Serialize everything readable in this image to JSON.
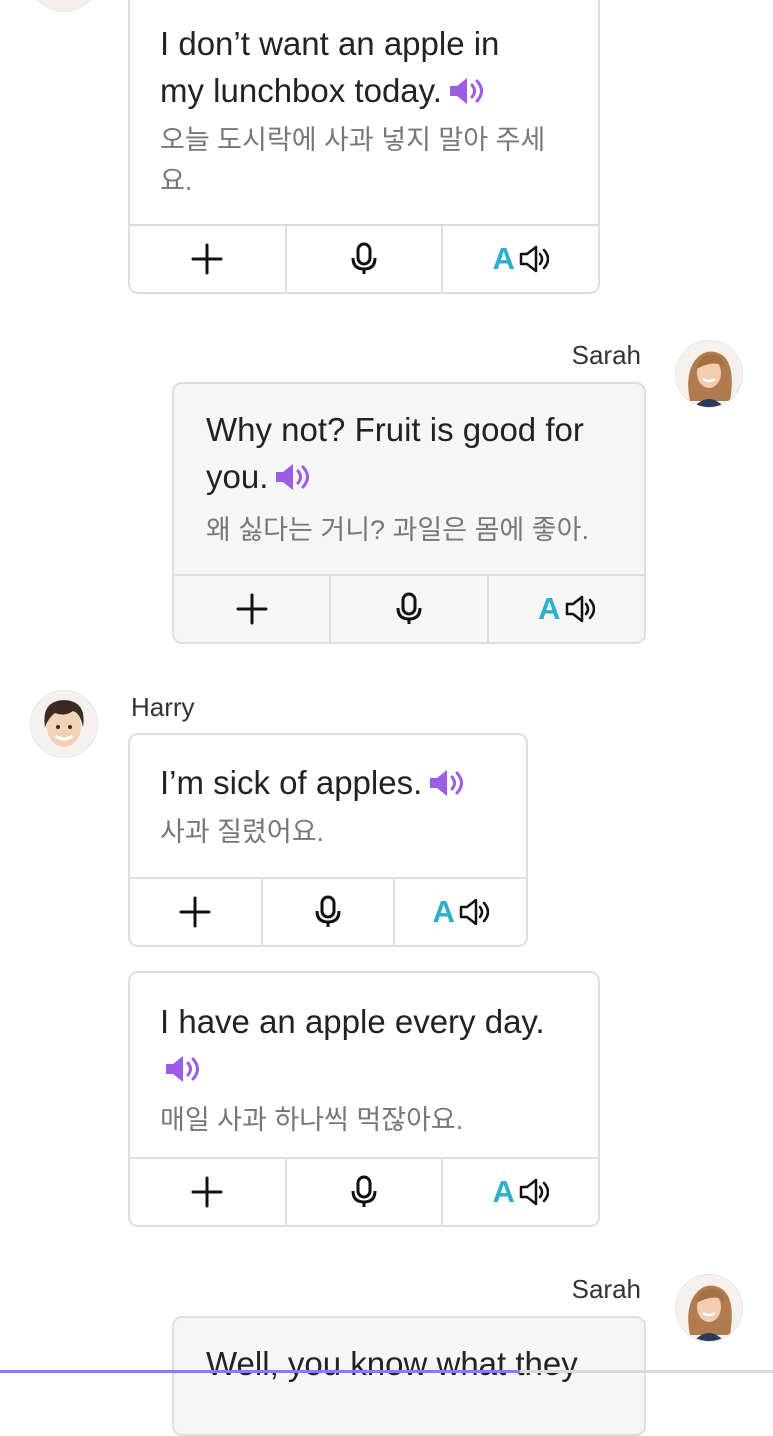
{
  "messages": [
    {
      "speaker": "",
      "english": "I don’t want an apple in my lunchbox today.",
      "english_lines": [
        "I don’t want an apple in",
        "my lunchbox today."
      ],
      "korean_lines": [
        "오늘 도시락에 사과 넣지 말아 주세",
        "요."
      ]
    },
    {
      "speaker": "Sarah",
      "english_lines": [
        "Why not? Fruit is good for",
        "you."
      ],
      "korean_lines": [
        "왜 싫다는 거니? 과일은 몸에 좋아."
      ]
    },
    {
      "speaker": "Harry",
      "english_lines": [
        "I’m sick of apples."
      ],
      "korean_lines": [
        "사과 질렸어요."
      ]
    },
    {
      "speaker": "",
      "english_lines": [
        "I have an apple every day.",
        ""
      ],
      "korean_lines": [
        "매일 사과 하나씩 먹잖아요."
      ]
    },
    {
      "speaker": "Sarah",
      "english_lines": [
        "Well, you know what they"
      ]
    }
  ],
  "actions": {
    "add_icon": "plus-icon",
    "record_icon": "microphone-icon",
    "listen_letter": "A",
    "listen_icon": "speaker-outline-icon"
  },
  "colors": {
    "accent_purple": "#9b5de5",
    "accent_teal": "#2ab0c8",
    "border": "#dedede",
    "korean_text": "#777777"
  }
}
